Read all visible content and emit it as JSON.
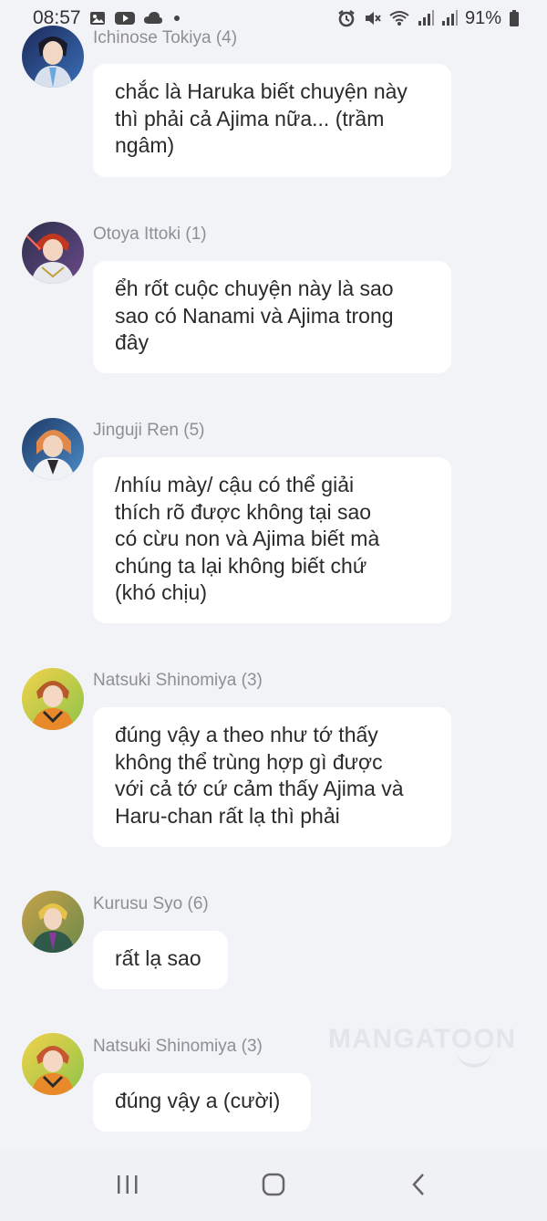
{
  "status_bar": {
    "time": "08:57",
    "battery": "91%"
  },
  "messages": [
    {
      "sender": "Ichinose Tokiya (4)",
      "text": "chắc là Haruka biết chuyện này\nthì phải cả Ajima nữa... (trầm\nngâm)"
    },
    {
      "sender": "Otoya Ittoki (1)",
      "text": "ểh rốt cuộc chuyện này là sao\nsao có Nanami và Ajima trong\nđây"
    },
    {
      "sender": "Jinguji Ren (5)",
      "text": "/nhíu mày/ cậu có thể giải\nthích rõ được không tại sao\ncó cừu non và Ajima biết mà\nchúng ta lại không biết chứ\n(khó chịu)"
    },
    {
      "sender": "Natsuki Shinomiya (3)",
      "text": "đúng vậy a theo như tớ thấy\nkhông thể trùng hợp gì được\nvới cả tớ cứ cảm thấy Ajima và\nHaru-chan rất lạ thì phải"
    },
    {
      "sender": "Kurusu Syo (6)",
      "text": "rất lạ sao"
    },
    {
      "sender": "Natsuki Shinomiya (3)",
      "text": "đúng vậy a (cười)"
    }
  ],
  "watermark": "MANGATOON",
  "nav": {
    "recents_icon": "recents-icon",
    "home_icon": "home-icon",
    "back_icon": "back-icon"
  }
}
